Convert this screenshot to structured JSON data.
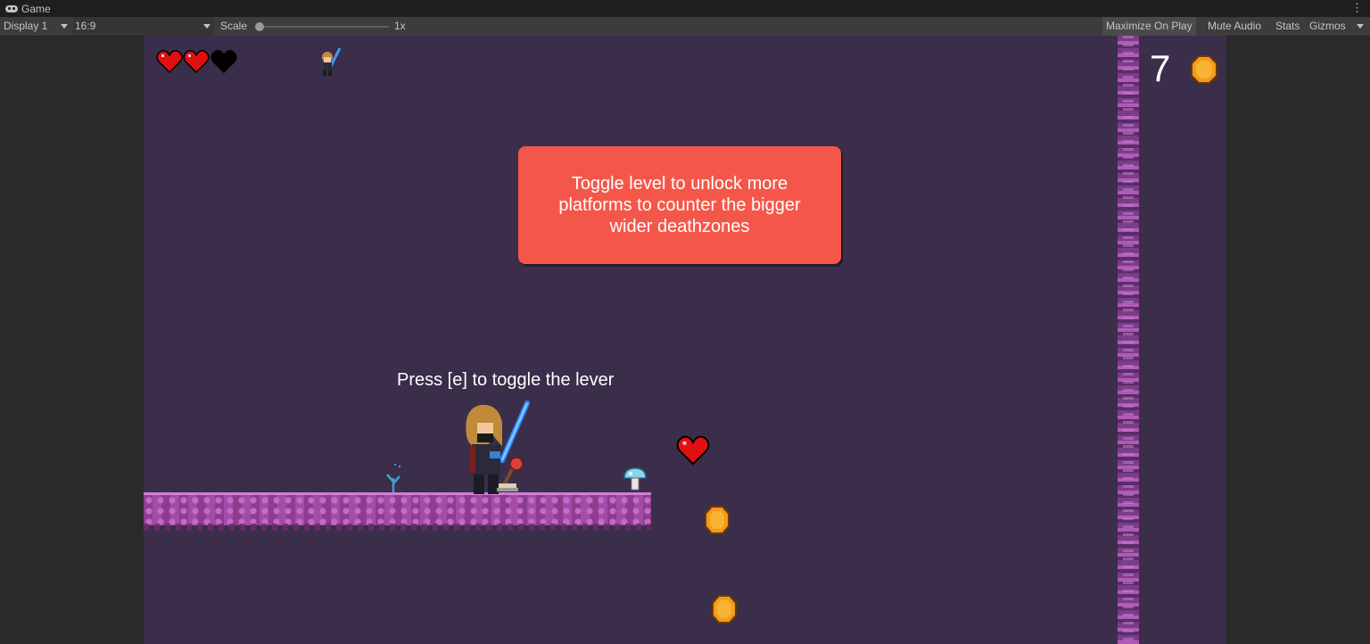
{
  "editor": {
    "tab_title": "Game",
    "toolbar": {
      "display": "Display 1",
      "aspect": "16:9",
      "scale_label": "Scale",
      "scale_value": "1x",
      "maximize_on_play": "Maximize On Play",
      "mute_audio": "Mute Audio",
      "stats": "Stats",
      "gizmos": "Gizmos"
    }
  },
  "game": {
    "hud": {
      "hearts_total": 3,
      "hearts_filled": 2,
      "coin_count": "7"
    },
    "tooltip_text": "Toggle level to unlock more platforms to counter the bigger wider deathzones",
    "hint_text": "Press [e] to toggle the lever",
    "colors": {
      "background": "#3a2e4a",
      "tooltip": "#f4574a",
      "platform": "#a24ca6",
      "heart": "#e01010",
      "coin": "#f59a1c"
    }
  }
}
